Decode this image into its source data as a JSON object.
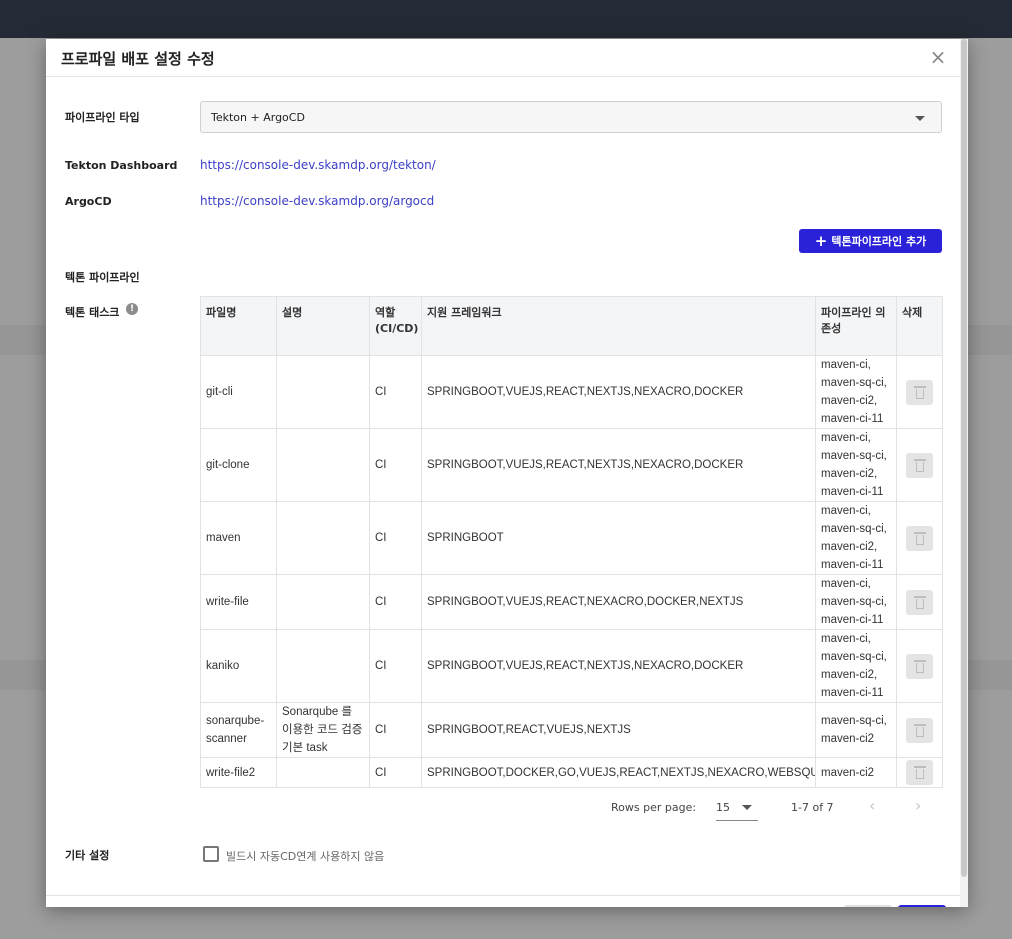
{
  "dialog": {
    "title": "프로파일 배포 설정 수정",
    "close_symbol": "×"
  },
  "form": {
    "pipeline_type_label": "파이프라인 타입",
    "pipeline_type_value": "Tekton + ArgoCD",
    "tekton_dashboard_label": "Tekton Dashboard",
    "tekton_dashboard_url": "https://console-dev.skamdp.org/tekton/",
    "argocd_label": "ArgoCD",
    "argocd_url": "https://console-dev.skamdp.org/argocd",
    "add_pipeline_button": "텍톤파이프라인 추가",
    "tekton_pipeline_label": "텍톤 파이프라인",
    "tekton_task_label": "텍톤 태스크",
    "other_settings_label": "기타 설정",
    "auto_cd_checkbox_label": "빌드시 자동CD연계 사용하지 않음",
    "auto_cd_checked": false
  },
  "table": {
    "headers": {
      "file_name": "파일명",
      "description": "설명",
      "role": "역할\n(CI/CD)",
      "frameworks": "지원 프레임워크",
      "dependencies": "파이프라인 의존성",
      "delete": "삭제"
    },
    "rows": [
      {
        "file_name": "git-cli",
        "description": "",
        "role": "CI",
        "frameworks": "SPRINGBOOT,VUEJS,REACT,NEXTJS,NEXACRO,DOCKER",
        "dependencies": "maven-ci,\nmaven-sq-ci,\nmaven-ci2,\nmaven-ci-11"
      },
      {
        "file_name": "git-clone",
        "description": "",
        "role": "CI",
        "frameworks": "SPRINGBOOT,VUEJS,REACT,NEXTJS,NEXACRO,DOCKER",
        "dependencies": "maven-ci,\nmaven-sq-ci,\nmaven-ci2,\nmaven-ci-11"
      },
      {
        "file_name": "maven",
        "description": "",
        "role": "CI",
        "frameworks": "SPRINGBOOT",
        "dependencies": "maven-ci,\nmaven-sq-ci,\nmaven-ci2,\nmaven-ci-11"
      },
      {
        "file_name": "write-file",
        "description": "",
        "role": "CI",
        "frameworks": "SPRINGBOOT,VUEJS,REACT,NEXACRO,DOCKER,NEXTJS",
        "dependencies": "maven-ci,\nmaven-sq-ci,\nmaven-ci-11"
      },
      {
        "file_name": "kaniko",
        "description": "",
        "role": "CI",
        "frameworks": "SPRINGBOOT,VUEJS,REACT,NEXTJS,NEXACRO,DOCKER",
        "dependencies": "maven-ci,\nmaven-sq-ci,\nmaven-ci2,\nmaven-ci-11"
      },
      {
        "file_name": "sonarqube-scanner",
        "description": "Sonarqube 를 이용한 코드 검증 기본 task",
        "role": "CI",
        "frameworks": "SPRINGBOOT,REACT,VUEJS,NEXTJS",
        "dependencies": "maven-sq-ci,\nmaven-ci2"
      },
      {
        "file_name": "write-file2",
        "description": "",
        "role": "CI",
        "frameworks": "SPRINGBOOT,DOCKER,GO,VUEJS,REACT,NEXTJS,NEXACRO,WEBSQUARE",
        "dependencies": "maven-ci2"
      }
    ]
  },
  "pagination": {
    "rows_per_page_label": "Rows per page:",
    "rows_per_page_value": "15",
    "range_text": "1-7 of 7",
    "prev_symbol": "‹",
    "next_symbol": "›"
  },
  "icons": {
    "info": "info-icon",
    "trash": "trash-icon",
    "close": "close-icon",
    "caret": "caret-down-icon",
    "plus": "plus-icon"
  },
  "colors": {
    "accent": "#2a22d8",
    "link": "#3c3fc7",
    "header_bg": "#f4f5f7",
    "topbar": "#252b36"
  }
}
